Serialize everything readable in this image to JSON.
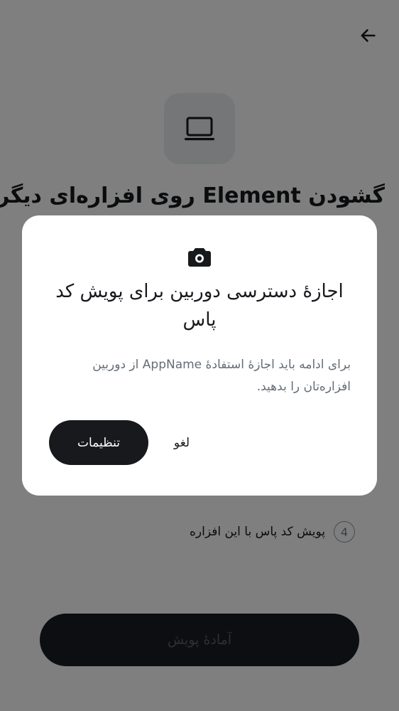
{
  "screen": {
    "back_icon": "arrow-left-icon",
    "device_icon": "laptop-icon",
    "title": "گشودن Element روی افزاره‌ای دیگر",
    "step": {
      "number": "4",
      "text": "پویش کد پاس با این افزاره"
    },
    "primary_button": "آمادهٔ پویش"
  },
  "dialog": {
    "icon": "camera-icon",
    "title": "اجازهٔ دسترسی دوربین برای پویش کد پاس",
    "body": "برای ادامه باید اجازهٔ استفادهٔ AppName از دوربین افزاره‌تان را بدهید.",
    "settings_button": "تنظیمات",
    "cancel_button": "لغو"
  },
  "colors": {
    "scrim": "#000000",
    "dialog_bg": "#ffffff",
    "primary_button_bg": "#17191c",
    "device_tile_bg": "#e9ecf1",
    "body_text": "#656d77"
  }
}
